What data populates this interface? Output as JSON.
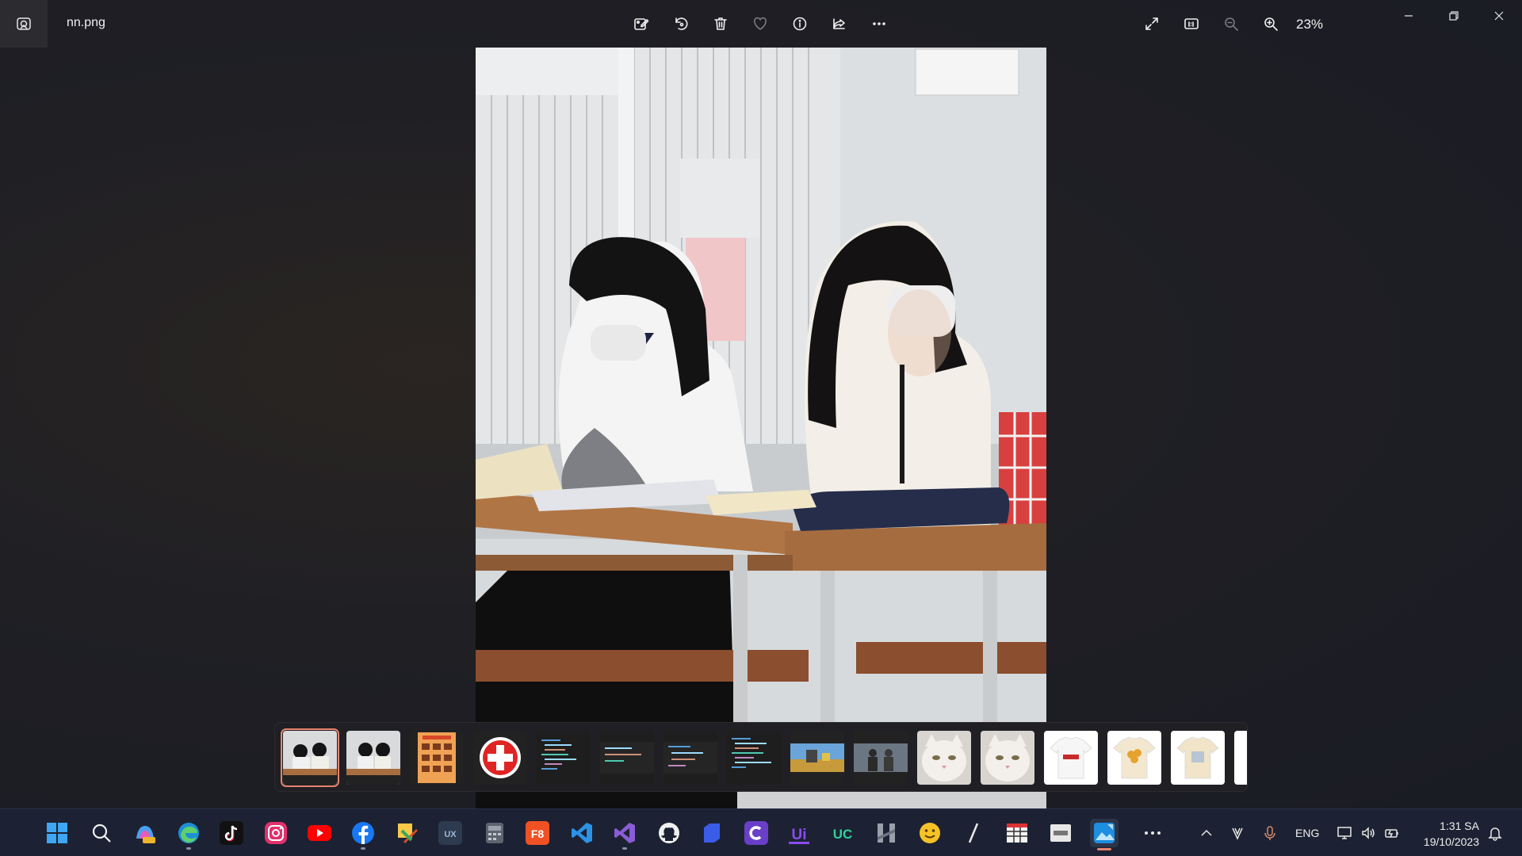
{
  "window": {
    "file_name": "nn.png",
    "zoom_level": "23%"
  },
  "toolbar": {
    "buttons": [
      "edit-image",
      "rotate",
      "delete",
      "favorite",
      "file-info",
      "share",
      "more"
    ]
  },
  "filmstrip": {
    "selected_index": 0,
    "thumbnails": [
      "students-photo-1",
      "students-photo-2",
      "food-menu",
      "red-cross",
      "code-editor-1",
      "code-editor-2",
      "code-editor-3",
      "code-editor-4",
      "game-scene",
      "people-scene",
      "cat-1",
      "cat-2",
      "gucci-shirt",
      "sunflower-shirt",
      "beige-shirt",
      "partial-thumb"
    ]
  },
  "taskbar": {
    "language": "ENG",
    "clock_time": "1:31 SA",
    "clock_date": "19/10/2023",
    "apps": [
      "start",
      "search",
      "copilot-pre",
      "edge",
      "tiktok",
      "instagram",
      "youtube",
      "facebook",
      "sticky-tools",
      "adobe-xd",
      "calculator",
      "f8",
      "vscode",
      "visual-studio",
      "github",
      "blue-app",
      "c-app",
      "ui-app",
      "uc-browser",
      "h-app",
      "emoji",
      "pen-app",
      "spreadsheet-app",
      "card-app",
      "photos",
      "more"
    ]
  },
  "colors": {
    "accent": "#e8836e",
    "taskbar_bg": "#1c2233"
  }
}
